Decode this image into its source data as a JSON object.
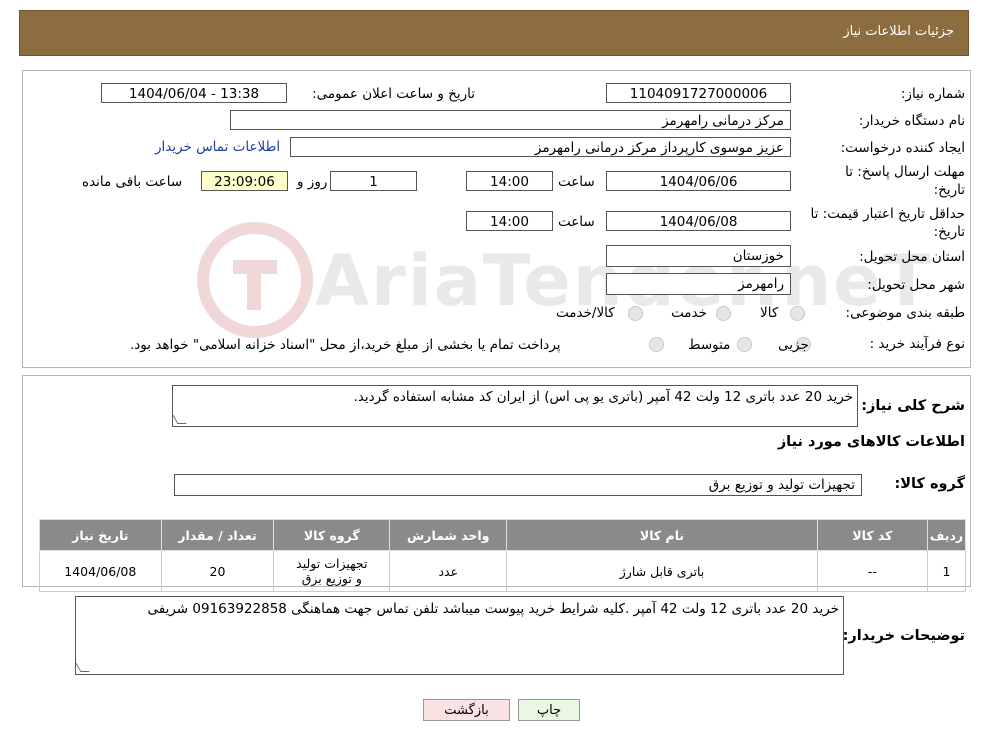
{
  "header": {
    "title": "جزئیات اطلاعات نیاز"
  },
  "watermark": {
    "brand": "AriaTender.neT"
  },
  "fields": {
    "need_number_label": "شماره نیاز:",
    "need_number": "1104091727000006",
    "announce_label": "تاریخ و ساعت اعلان عمومی:",
    "announce_value": "1404/06/04 - 13:38",
    "buyer_org_label": "نام دستگاه خریدار:",
    "buyer_org": "مرکز درمانی رامهرمز",
    "creator_label": "ایجاد کننده درخواست:",
    "creator": "عزیز موسوی کارپرداز مرکز درمانی رامهرمز",
    "contact_link": "اطلاعات تماس خریدار",
    "deadline_label_line1": "مهلت ارسال پاسخ: تا",
    "deadline_label_line2": "تاریخ:",
    "deadline_date": "1404/06/06",
    "time_label": "ساعت",
    "deadline_time": "14:00",
    "days_value": "1",
    "days_label": "روز و",
    "remaining_time": "23:09:06",
    "remaining_label": "ساعت باقی مانده",
    "validity_label_line1": "حداقل تاریخ اعتبار قیمت: تا",
    "validity_label_line2": "تاریخ:",
    "validity_date": "1404/06/08",
    "validity_time": "14:00",
    "province_label": "استان محل تحویل:",
    "province": "خوزستان",
    "city_label": "شهر محل تحویل:",
    "city": "رامهرمز",
    "category_label": "طبقه بندی موضوعی:",
    "category_options": [
      "کالا",
      "خدمت",
      "کالا/خدمت"
    ],
    "process_label": "نوع فرآیند خرید :",
    "process_options": [
      "جزیی",
      "متوسط"
    ],
    "process_note": "پرداخت تمام یا بخشی از مبلغ خرید،از محل \"اسناد خزانه اسلامی\" خواهد بود."
  },
  "summary": {
    "label": "شرح کلی نیاز:",
    "text": "خرید 20 عدد باتری 12 ولت 42 آمپر (باتری یو پی اس) از ایران کد مشابه استفاده گردید."
  },
  "goods": {
    "section_title": "اطلاعات کالاهای مورد نیاز",
    "group_label": "گروه کالا:",
    "group_value": "تجهیزات تولید و توزیع برق",
    "columns": [
      "ردیف",
      "کد کالا",
      "نام کالا",
      "واحد شمارش",
      "گروه کالا",
      "تعداد / مقدار",
      "تاریخ نیاز"
    ],
    "rows": [
      {
        "row": "1",
        "code": "--",
        "name": "باتری قابل شارژ",
        "unit": "عدد",
        "group": "تجهیزات تولید و توزیع برق",
        "qty": "20",
        "date": "1404/06/08"
      }
    ]
  },
  "buyer_notes": {
    "label": "توضیحات خریدار:",
    "text": "خرید 20 عدد باتری 12 ولت 42 آمپر .کلیه شرایط خرید پیوست میباشد تلفن تماس جهت هماهنگی 09163922858 شریفی"
  },
  "buttons": {
    "print": "چاپ",
    "back": "بازگشت"
  }
}
